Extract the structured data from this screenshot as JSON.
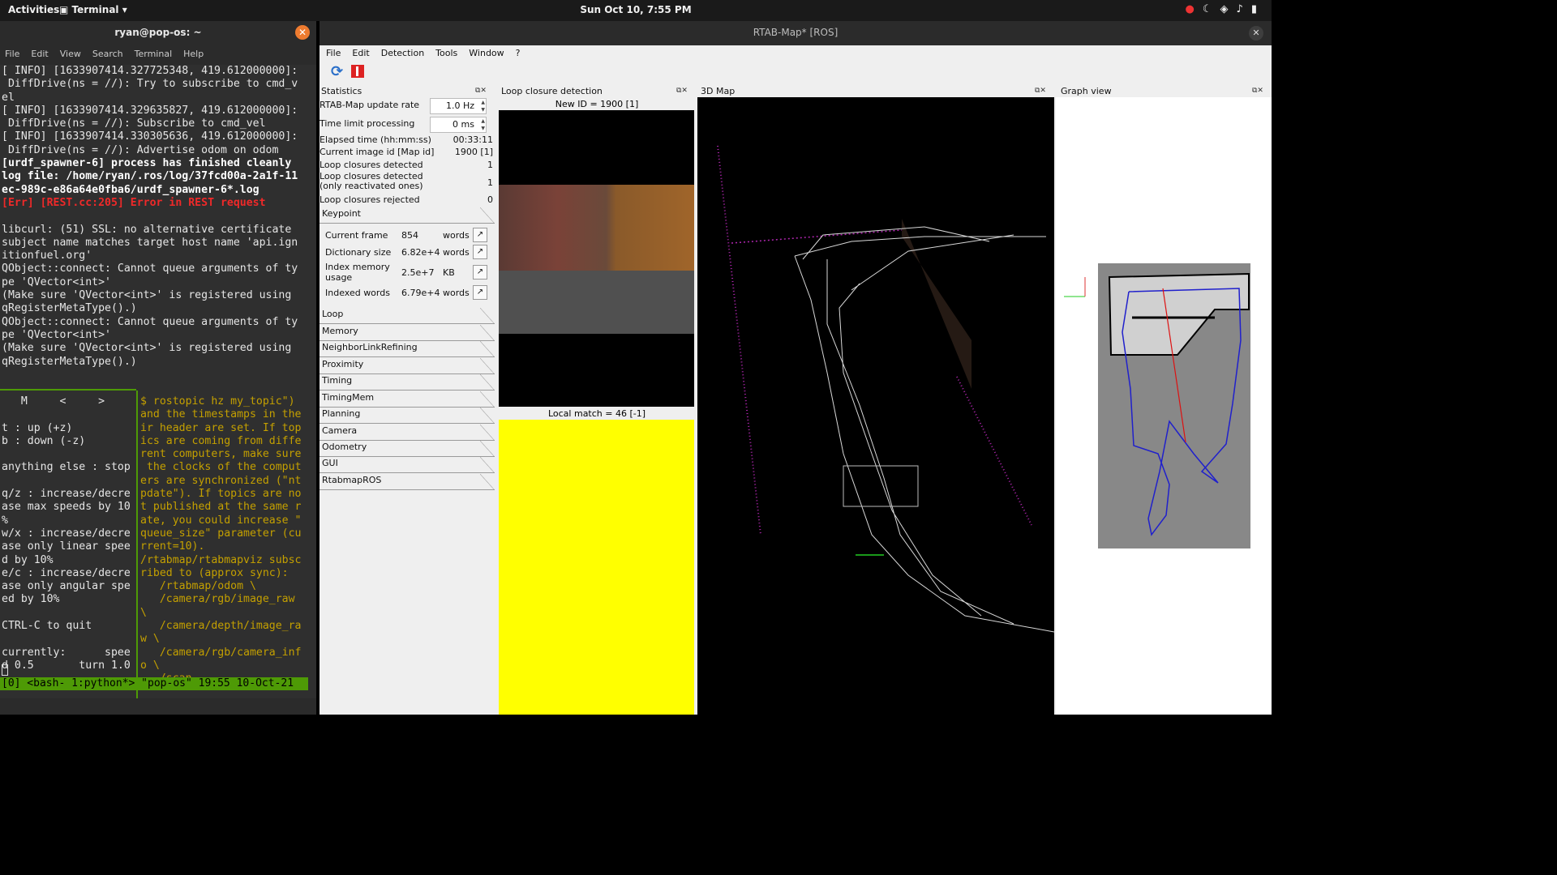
{
  "topbar": {
    "activities": "Activities",
    "app": "Terminal ▾",
    "clock": "Sun Oct 10, 7:55 PM"
  },
  "terminal": {
    "title": "ryan@pop-os: ~",
    "menu": [
      "File",
      "Edit",
      "View",
      "Search",
      "Terminal",
      "Help"
    ],
    "lines": [
      {
        "t": "[ INFO] [1633907414.327725348, 419.612000000]:",
        "s": ""
      },
      {
        "t": " DiffDrive(ns = //): Try to subscribe to cmd_v",
        "s": ""
      },
      {
        "t": "el",
        "s": ""
      },
      {
        "t": "[ INFO] [1633907414.329635827, 419.612000000]:",
        "s": ""
      },
      {
        "t": " DiffDrive(ns = //): Subscribe to cmd_vel",
        "s": ""
      },
      {
        "t": "[ INFO] [1633907414.330305636, 419.612000000]:",
        "s": ""
      },
      {
        "t": " DiffDrive(ns = //): Advertise odom on odom",
        "s": ""
      },
      {
        "t": "[urdf_spawner-6] process has finished cleanly",
        "s": "b"
      },
      {
        "t": "log file: /home/ryan/.ros/log/37fcd00a-2a1f-11",
        "s": "b"
      },
      {
        "t": "ec-989c-e86a64e0fba6/urdf_spawner-6*.log",
        "s": "b"
      },
      {
        "t": "[Err] [REST.cc:205] Error in REST request",
        "s": "e"
      },
      {
        "t": "",
        "s": ""
      },
      {
        "t": "libcurl: (51) SSL: no alternative certificate",
        "s": ""
      },
      {
        "t": "subject name matches target host name 'api.ign",
        "s": ""
      },
      {
        "t": "itionfuel.org'",
        "s": ""
      },
      {
        "t": "QObject::connect: Cannot queue arguments of ty",
        "s": ""
      },
      {
        "t": "pe 'QVector<int>'",
        "s": ""
      },
      {
        "t": "(Make sure 'QVector<int>' is registered using",
        "s": ""
      },
      {
        "t": "qRegisterMetaType().)",
        "s": ""
      },
      {
        "t": "QObject::connect: Cannot queue arguments of ty",
        "s": ""
      },
      {
        "t": "pe 'QVector<int>'",
        "s": ""
      },
      {
        "t": "(Make sure 'QVector<int>' is registered using",
        "s": ""
      },
      {
        "t": "qRegisterMetaType().)",
        "s": ""
      }
    ],
    "left_pane": "   M     <     >\n\nt : up (+z)\nb : down (-z)\n\nanything else : stop\n\nq/z : increase/decre\nase max speeds by 10\n%\nw/x : increase/decre\nase only linear spee\nd by 10%\ne/c : increase/decre\nase only angular spe\ned by 10%\n\nCTRL-C to quit\n\ncurrently:      spee\nd 0.5       turn 1.0",
    "right_pane": "$ rostopic hz my_topic\")\nand the timestamps in the\nir header are set. If top\nics are coming from diffe\nrent computers, make sure\n the clocks of the comput\ners are synchronized (\"nt\npdate\"). If topics are no\nt published at the same r\nate, you could increase \"\nqueue_size\" parameter (cu\nrrent=10).\n/rtabmap/rtabmapviz subsc\nribed to (approx sync):\n   /rtabmap/odom \\\n   /camera/rgb/image_raw\n\\\n   /camera/depth/image_ra\nw \\\n   /camera/rgb/camera_inf\no \\\n   /scan",
    "status": "[0] <bash- 1:python*> \"pop-os\" 19:55 10-Oct-21"
  },
  "rtab": {
    "title": "RTAB-Map* [ROS]",
    "menu": [
      "File",
      "Edit",
      "Detection",
      "Tools",
      "Window",
      "?"
    ],
    "docks": {
      "stats": "Statistics",
      "loop": "Loop closure detection",
      "map": "3D Map",
      "graph": "Graph view"
    },
    "stats": {
      "update_rate_label": "RTAB-Map update rate",
      "update_rate": "1.0 Hz",
      "time_limit_label": "Time limit processing",
      "time_limit": "0 ms",
      "rows": [
        {
          "l": "Elapsed time (hh:mm:ss)",
          "v": "00:33:11"
        },
        {
          "l": "Current image id [Map id]",
          "v": "1900 [1]"
        },
        {
          "l": "Loop closures detected",
          "v": "1"
        },
        {
          "l": "Loop closures detected\n(only reactivated ones)",
          "v": "1"
        },
        {
          "l": "Loop closures rejected",
          "v": "0"
        }
      ],
      "keypoint_label": "Keypoint",
      "keypoints": [
        {
          "n": "Current frame",
          "v": "854",
          "u": "words"
        },
        {
          "n": "Dictionary size",
          "v": "6.82e+4",
          "u": "words"
        },
        {
          "n": "Index memory\nusage",
          "v": "2.5e+7",
          "u": "KB"
        },
        {
          "n": "Indexed words",
          "v": "6.79e+4",
          "u": "words"
        }
      ],
      "sections": [
        "Loop",
        "Memory",
        "NeighborLinkRefining",
        "Proximity",
        "Timing",
        "TimingMem",
        "Planning",
        "Camera",
        "Odometry",
        "GUI",
        "RtabmapROS"
      ]
    },
    "loop": {
      "new_id": "New ID = 1900 [1]",
      "local_match": "Local match = 46 [-1]"
    }
  }
}
